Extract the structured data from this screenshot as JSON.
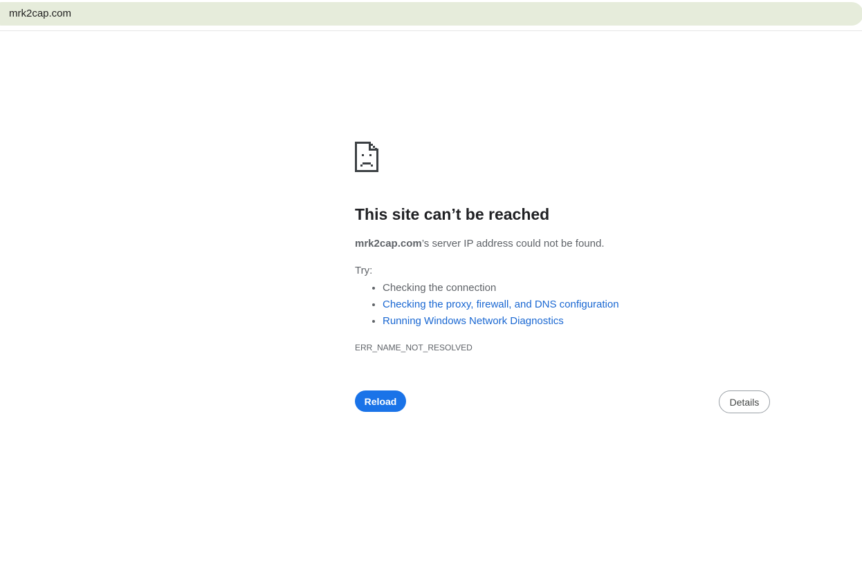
{
  "browser": {
    "url": "mrk2cap.com"
  },
  "error_page": {
    "icon": "sad-page-icon",
    "heading": "This site can’t be reached",
    "summary_host": "mrk2cap.com",
    "summary_rest": "’s server IP address could not be found.",
    "try_label": "Try:",
    "suggestions": [
      {
        "text": "Checking the connection",
        "is_link": false
      },
      {
        "text": "Checking the proxy, firewall, and DNS configuration",
        "is_link": true
      },
      {
        "text": "Running Windows Network Diagnostics",
        "is_link": true
      }
    ],
    "error_code": "ERR_NAME_NOT_RESOLVED",
    "reload_label": "Reload",
    "details_label": "Details"
  },
  "colors": {
    "omnibox_bg": "#e6ecdb",
    "link": "#1967d2",
    "primary_button": "#1a73e8",
    "text_secondary": "#5f6368"
  }
}
